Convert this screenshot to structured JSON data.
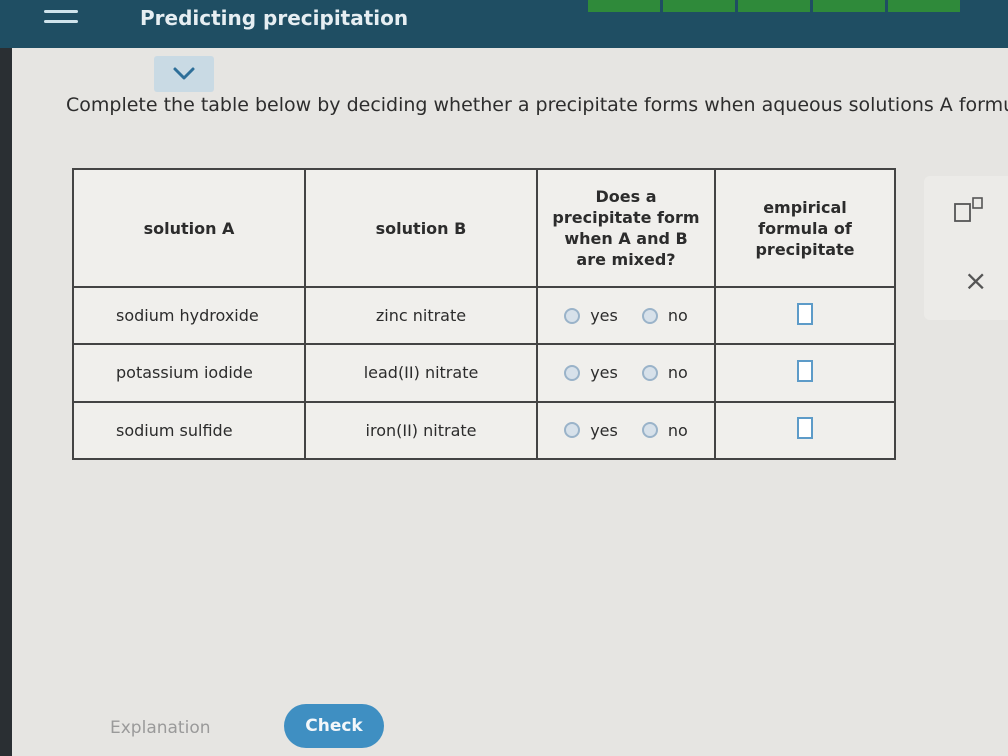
{
  "header": {
    "topic_title": "Predicting precipitation",
    "progress_segments": 5
  },
  "instructions": "Complete the table below by deciding whether a precipitate forms when aqueous solutions A formula in the last column.",
  "table": {
    "headers": {
      "solution_a": "solution A",
      "solution_b": "solution B",
      "precipitate": [
        "Does a",
        "precipitate form",
        "when A and B",
        "are mixed?"
      ],
      "formula": [
        "empirical",
        "formula of",
        "precipitate"
      ]
    },
    "rows": [
      {
        "solution_a": "sodium hydroxide",
        "solution_b": "zinc nitrate",
        "yes_label": "yes",
        "no_label": "no"
      },
      {
        "solution_a": "potassium iodide",
        "solution_b": "lead(II) nitrate",
        "yes_label": "yes",
        "no_label": "no"
      },
      {
        "solution_a": "sodium sulfide",
        "solution_b": "iron(II) nitrate",
        "yes_label": "yes",
        "no_label": "no"
      }
    ]
  },
  "tools": {
    "superscript_icon": "superscript-box-icon",
    "clear_label": "×"
  },
  "footer": {
    "explanation_label": "Explanation",
    "check_label": "Check"
  },
  "colors": {
    "header_bar": "#1f4e63",
    "progress": "#2f8a3a",
    "check_button": "#3f8fc2",
    "radio": "#9ab3c9",
    "answer_box_border": "#5d9bc8"
  }
}
